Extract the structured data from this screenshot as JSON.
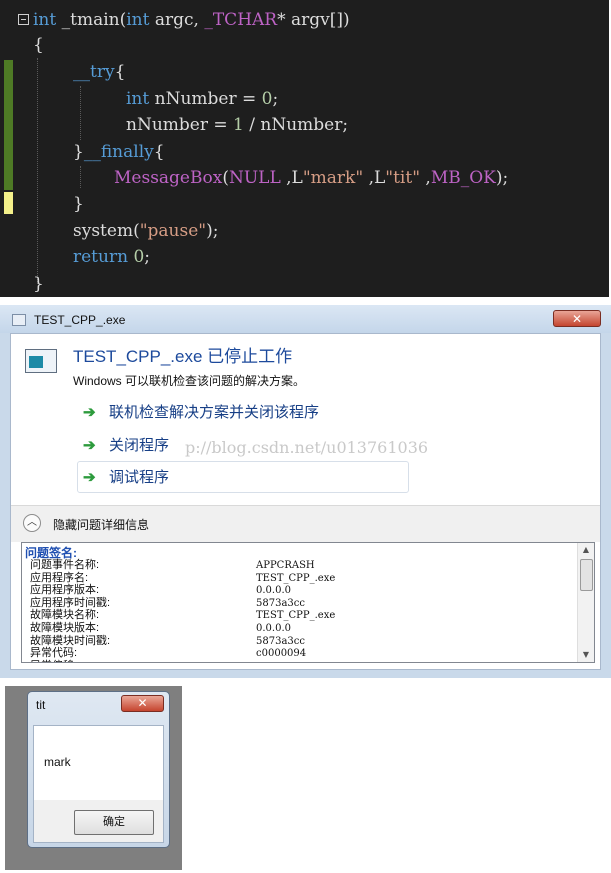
{
  "code_editor": {
    "lines": [
      [
        {
          "t": "int",
          "c": "kw"
        },
        {
          "t": " _tmain(",
          "c": "pl"
        },
        {
          "t": "int",
          "c": "kw"
        },
        {
          "t": " argc, ",
          "c": "pl"
        },
        {
          "t": "_TCHAR",
          "c": "mac"
        },
        {
          "t": "* argv[])",
          "c": "pl"
        }
      ],
      [
        {
          "t": "{",
          "c": "pl"
        }
      ],
      [
        {
          "t": "__try",
          "c": "kw"
        },
        {
          "t": "{",
          "c": "pl"
        }
      ],
      [
        {
          "t": "int",
          "c": "kw"
        },
        {
          "t": " nNumber = ",
          "c": "pl"
        },
        {
          "t": "0",
          "c": "num"
        },
        {
          "t": ";",
          "c": "pl"
        }
      ],
      [
        {
          "t": "nNumber = ",
          "c": "pl"
        },
        {
          "t": "1",
          "c": "num"
        },
        {
          "t": " / nNumber;",
          "c": "pl"
        }
      ],
      [
        {
          "t": "}",
          "c": "pl"
        },
        {
          "t": "__finally",
          "c": "kw"
        },
        {
          "t": "{",
          "c": "pl"
        }
      ],
      [
        {
          "t": "MessageBox",
          "c": "mac"
        },
        {
          "t": "(",
          "c": "pl"
        },
        {
          "t": "NULL",
          "c": "mac"
        },
        {
          "t": " ,L",
          "c": "pl"
        },
        {
          "t": "\"mark\"",
          "c": "str"
        },
        {
          "t": " ,L",
          "c": "pl"
        },
        {
          "t": "\"tit\"",
          "c": "str"
        },
        {
          "t": " ,",
          "c": "pl"
        },
        {
          "t": "MB_OK",
          "c": "mac"
        },
        {
          "t": ");",
          "c": "pl"
        }
      ],
      [
        {
          "t": "}",
          "c": "pl"
        }
      ],
      [
        {
          "t": "system(",
          "c": "pl"
        },
        {
          "t": "\"pause\"",
          "c": "str"
        },
        {
          "t": ");",
          "c": "pl"
        }
      ],
      [
        {
          "t": "return",
          "c": "kw"
        },
        {
          "t": " ",
          "c": "pl"
        },
        {
          "t": "0",
          "c": "num"
        },
        {
          "t": ";",
          "c": "pl"
        }
      ],
      [
        {
          "t": "}",
          "c": "pl"
        }
      ]
    ]
  },
  "crash_dialog": {
    "window_title": "TEST_CPP_.exe",
    "close_glyph": "✕",
    "heading": "TEST_CPP_.exe 已停止工作",
    "subtext": "Windows 可以联机检查该问题的解决方案。",
    "options": [
      "联机检查解决方案并关闭该程序",
      "关闭程序",
      "调试程序"
    ],
    "watermark": "p://blog.csdn.net/u013761036",
    "hide_details_label": "隐藏问题详细信息",
    "signature_title": "问题签名:",
    "details": [
      {
        "key": "问题事件名称:",
        "value": "APPCRASH"
      },
      {
        "key": "应用程序名:",
        "value": "TEST_CPP_.exe"
      },
      {
        "key": "应用程序版本:",
        "value": "0.0.0.0"
      },
      {
        "key": "应用程序时间戳:",
        "value": "5873a3cc"
      },
      {
        "key": "故障模块名称:",
        "value": "TEST_CPP_.exe"
      },
      {
        "key": "故障模块版本:",
        "value": "0.0.0.0"
      },
      {
        "key": "故障模块时间戳:",
        "value": "5873a3cc"
      },
      {
        "key": "异常代码:",
        "value": "c0000094"
      },
      {
        "key": "异常偏移:",
        "value": ""
      }
    ]
  },
  "message_box": {
    "title": "tit",
    "close_glyph": "✕",
    "text": "mark",
    "ok_label": "确定"
  },
  "colors": {
    "editor_bg": "#1e1e1e",
    "keyword": "#569cd6",
    "macro": "#bd63c5",
    "string": "#d69d85",
    "change_green": "#4e7a25",
    "change_yellow": "#f4f08a",
    "link_blue": "#173f86",
    "arrow_green": "#2d9b3d"
  }
}
